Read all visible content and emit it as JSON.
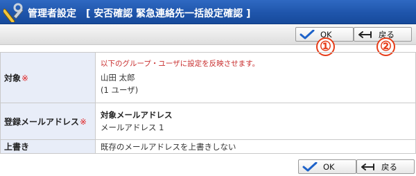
{
  "header": {
    "title": "管理者設定",
    "subtitle": "[ 安否確認 緊急連絡先一括設定確認 ]"
  },
  "buttons": {
    "ok_label": "OK",
    "back_label": "戻る"
  },
  "markers": [
    "①",
    "②"
  ],
  "rows": [
    {
      "label": "対象",
      "required_mark": "※",
      "notice": "以下のグループ・ユーザに設定を反映させます。",
      "user_name": "山田 太郎",
      "user_count": "(1 ユーザ)"
    },
    {
      "label": "登録メールアドレス",
      "required_mark": "※",
      "heading": "対象メールアドレス",
      "value": "メールアドレス 1"
    },
    {
      "label": "上書き",
      "value": "既存のメールアドレスを上書きしない"
    }
  ],
  "colors": {
    "title_bar": "#1f55ab",
    "label_cell": "#e8edf8",
    "required": "#e02020",
    "notice": "#c82c2c",
    "marker": "#e63c18"
  },
  "icons": {
    "title": "admin-tools-icon",
    "ok": "checkmark-icon",
    "back": "return-arrow-icon"
  }
}
